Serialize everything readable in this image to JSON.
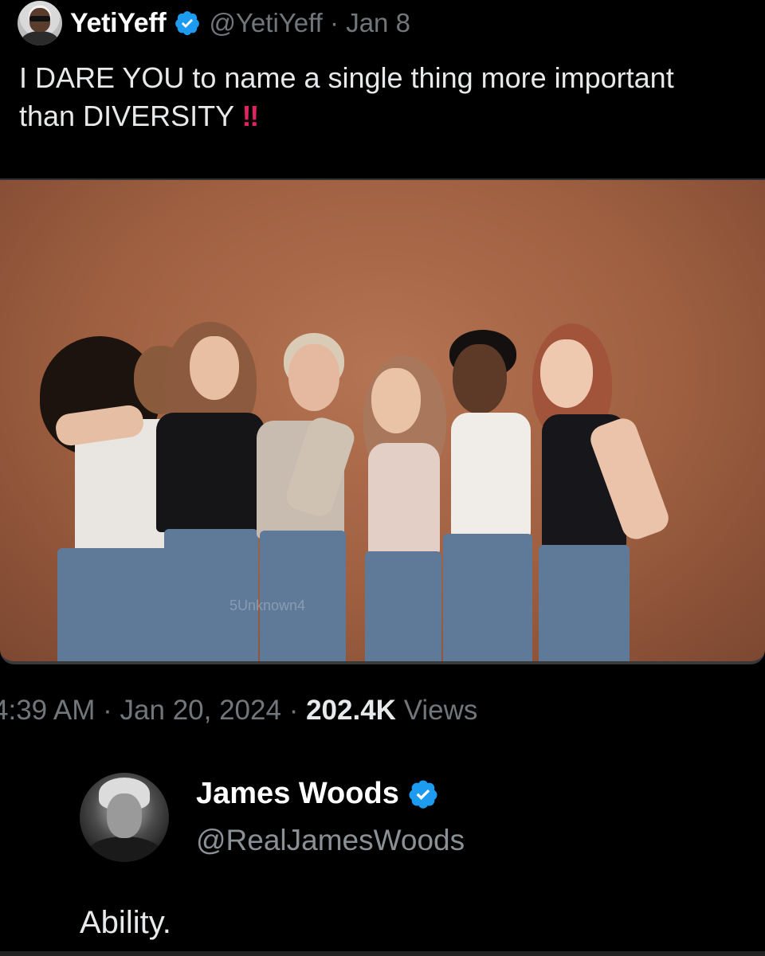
{
  "tweet": {
    "display_name": "YetiYeff",
    "handle": "@YetiYeff",
    "date": "Jan 8",
    "text": "I DARE YOU to name a single thing more important than DIVERSITY",
    "emphasis": "‼",
    "verified_icon": "verified-badge-icon",
    "image_watermark": "5Unknown4"
  },
  "meta": {
    "time": "4:39 AM",
    "date": "Jan 20, 2024",
    "views_count": "202.4K",
    "views_label": "Views"
  },
  "reply": {
    "display_name": "James Woods",
    "handle": "@RealJamesWoods",
    "text": "Ability.",
    "verified_icon": "verified-badge-icon"
  },
  "colors": {
    "background": "#000000",
    "verified": "#1d9bf0",
    "emphasis": "#e0245e",
    "photo_backdrop": "#a8674a",
    "muted_text": "#71767b"
  }
}
